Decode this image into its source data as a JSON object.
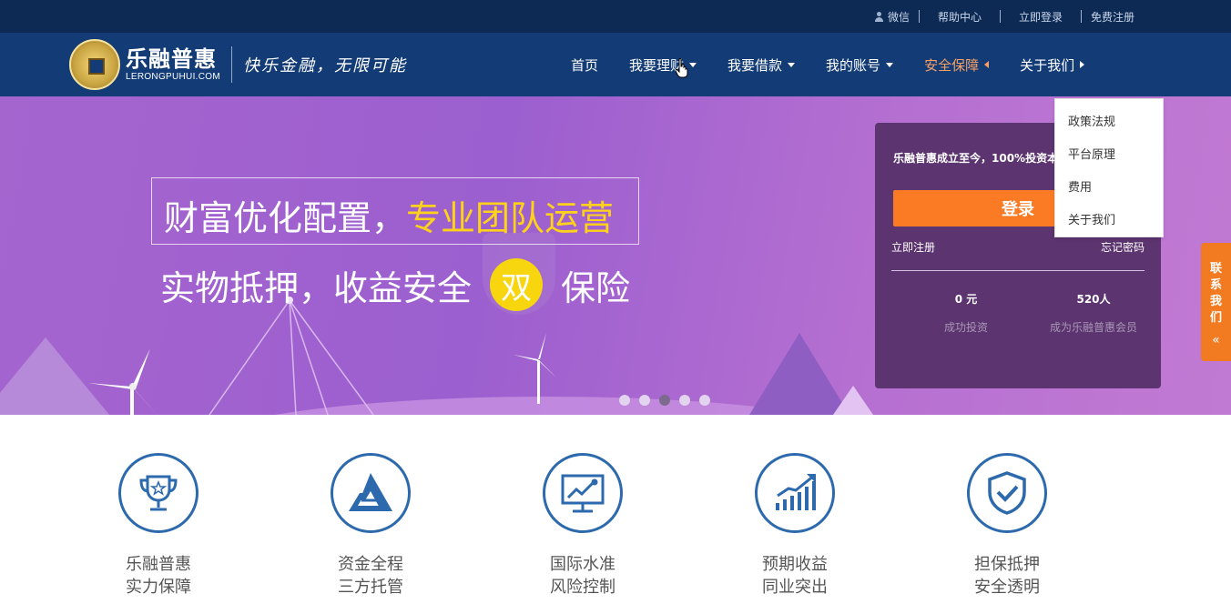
{
  "topbar": {
    "wechat": "微信",
    "help": "帮助中心",
    "login": "立即登录",
    "register": "免费注册"
  },
  "brand": {
    "name_cn": "乐融普惠",
    "name_en": "LERONGPUHUI.COM",
    "slogan": "快乐金融，无限可能"
  },
  "nav": {
    "items": [
      {
        "label": "首页"
      },
      {
        "label": "我要理财"
      },
      {
        "label": "我要借款"
      },
      {
        "label": "我的账号"
      },
      {
        "label": "安全保障"
      },
      {
        "label": "关于我们"
      }
    ],
    "active_color": "#f7a064"
  },
  "dropdown": {
    "items": [
      "政策法规",
      "平台原理",
      "费用",
      "关于我们"
    ]
  },
  "banner": {
    "line1_a": "财富优化配置，",
    "line1_b": "专业团队运营",
    "line2_a": "实物抵押，收益安全",
    "line2_badge": "双",
    "line2_b": "保险",
    "slides": 5,
    "active_slide": 3
  },
  "login_panel": {
    "tagline": "乐融普惠成立至今，100%投资本息安全无忧",
    "button": "登录",
    "register": "立即注册",
    "forgot": "忘记密码",
    "stats": [
      {
        "value": "0 元",
        "label": "成功投资"
      },
      {
        "value": "520人",
        "label": "成为乐融普惠会员"
      }
    ]
  },
  "contact": {
    "label": "联系我们",
    "chars": [
      "联",
      "系",
      "我",
      "们"
    ]
  },
  "features": [
    {
      "icon": "trophy-icon",
      "line1": "乐融普惠",
      "line2": "实力保障"
    },
    {
      "icon": "triangle-icon",
      "line1": "资金全程",
      "line2": "三方托管"
    },
    {
      "icon": "monitor-chart-icon",
      "line1": "国际水准",
      "line2": "风险控制"
    },
    {
      "icon": "growth-chart-icon",
      "line1": "预期收益",
      "line2": "同业突出"
    },
    {
      "icon": "shield-check-icon",
      "line1": "担保抵押",
      "line2": "安全透明"
    }
  ],
  "colors": {
    "topbar": "#0d2a54",
    "navbar": "#133c76",
    "accent_orange": "#fb7b24",
    "icon_blue": "#2c69ad",
    "highlight_yellow": "#ffd21a"
  }
}
